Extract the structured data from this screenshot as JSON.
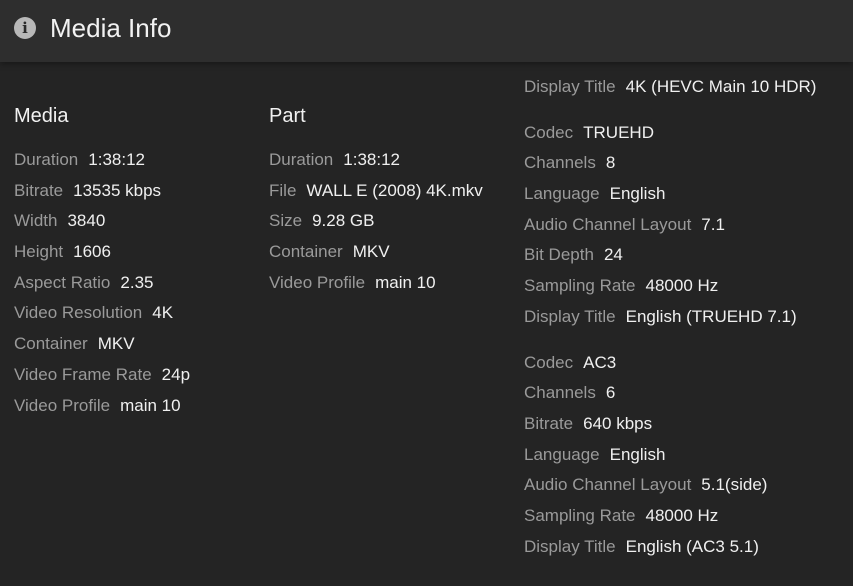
{
  "header": {
    "title": "Media Info",
    "icon": "info-icon"
  },
  "media": {
    "heading": "Media",
    "rows": [
      {
        "label": "Duration",
        "value": "1:38:12"
      },
      {
        "label": "Bitrate",
        "value": "13535 kbps"
      },
      {
        "label": "Width",
        "value": "3840"
      },
      {
        "label": "Height",
        "value": "1606"
      },
      {
        "label": "Aspect Ratio",
        "value": "2.35"
      },
      {
        "label": "Video Resolution",
        "value": "4K"
      },
      {
        "label": "Container",
        "value": "MKV"
      },
      {
        "label": "Video Frame Rate",
        "value": "24p"
      },
      {
        "label": "Video Profile",
        "value": "main 10"
      }
    ]
  },
  "part": {
    "heading": "Part",
    "rows": [
      {
        "label": "Duration",
        "value": "1:38:12"
      },
      {
        "label": "File",
        "value": "WALL E (2008) 4K.mkv"
      },
      {
        "label": "Size",
        "value": "9.28 GB"
      },
      {
        "label": "Container",
        "value": "MKV"
      },
      {
        "label": "Video Profile",
        "value": "main 10"
      }
    ]
  },
  "streams": [
    {
      "rows": [
        {
          "label": "Display Title",
          "value": "4K (HEVC Main 10 HDR)"
        }
      ]
    },
    {
      "rows": [
        {
          "label": "Codec",
          "value": "TRUEHD"
        },
        {
          "label": "Channels",
          "value": "8"
        },
        {
          "label": "Language",
          "value": "English"
        },
        {
          "label": "Audio Channel Layout",
          "value": "7.1"
        },
        {
          "label": "Bit Depth",
          "value": "24"
        },
        {
          "label": "Sampling Rate",
          "value": "48000 Hz"
        },
        {
          "label": "Display Title",
          "value": "English (TRUEHD 7.1)"
        }
      ]
    },
    {
      "rows": [
        {
          "label": "Codec",
          "value": "AC3"
        },
        {
          "label": "Channels",
          "value": "6"
        },
        {
          "label": "Bitrate",
          "value": "640 kbps"
        },
        {
          "label": "Language",
          "value": "English"
        },
        {
          "label": "Audio Channel Layout",
          "value": "5.1(side)"
        },
        {
          "label": "Sampling Rate",
          "value": "48000 Hz"
        },
        {
          "label": "Display Title",
          "value": "English (AC3 5.1)"
        }
      ]
    }
  ],
  "colors": {
    "background": "#242424",
    "header_background": "#2e2e2e",
    "label": "#9a9a9a",
    "value": "#f0f0f0"
  }
}
